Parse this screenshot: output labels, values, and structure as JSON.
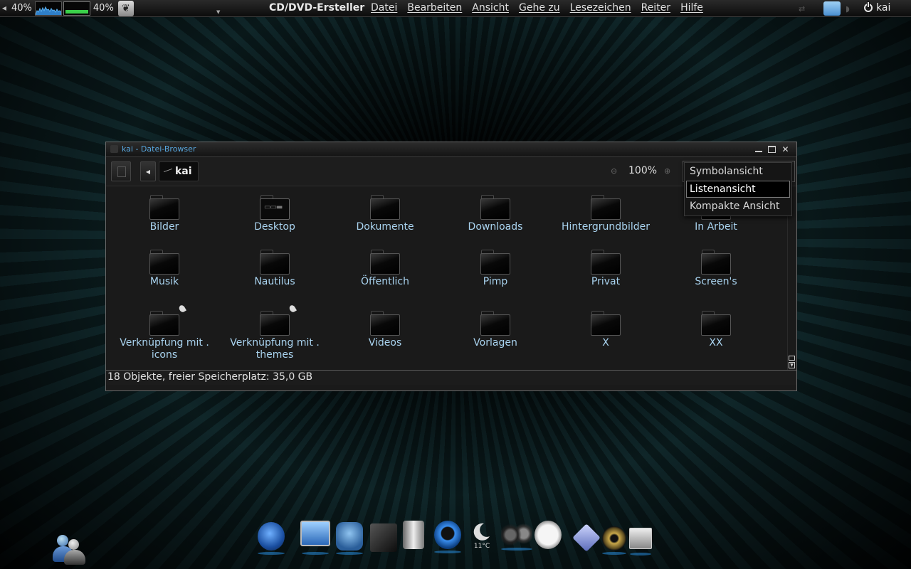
{
  "top_panel": {
    "cpu_percent": "40%",
    "mem_percent": "40%",
    "app_title": "CD/DVD-Ersteller",
    "menu": [
      "Datei",
      "Bearbeiten",
      "Ansicht",
      "Gehe zu",
      "Lesezeichen",
      "Reiter",
      "Hilfe"
    ],
    "user": "kai"
  },
  "window": {
    "title": "kai - Datei-Browser",
    "path": "kai",
    "zoom": "100%",
    "view_options": [
      "Symbolansicht",
      "Listenansicht",
      "Kompakte Ansicht"
    ],
    "selected_view": "Listenansicht",
    "items": [
      {
        "label": "Bilder",
        "kind": "folder"
      },
      {
        "label": "Desktop",
        "kind": "desktop"
      },
      {
        "label": "Dokumente",
        "kind": "folder"
      },
      {
        "label": "Downloads",
        "kind": "folder"
      },
      {
        "label": "Hintergrundbilder",
        "kind": "folder"
      },
      {
        "label": "In Arbeit",
        "kind": "folder"
      },
      {
        "label": "Musik",
        "kind": "folder"
      },
      {
        "label": "Nautilus",
        "kind": "folder"
      },
      {
        "label": "Öffentlich",
        "kind": "folder"
      },
      {
        "label": "Pimp",
        "kind": "folder"
      },
      {
        "label": "Privat",
        "kind": "folder"
      },
      {
        "label": "Screen's",
        "kind": "folder"
      },
      {
        "label": "Verknüpfung mit . icons",
        "kind": "link"
      },
      {
        "label": "Verknüpfung mit . themes",
        "kind": "link"
      },
      {
        "label": "Videos",
        "kind": "folder"
      },
      {
        "label": "Vorlagen",
        "kind": "folder"
      },
      {
        "label": "X",
        "kind": "folder"
      },
      {
        "label": "XX",
        "kind": "folder"
      }
    ],
    "status": "18 Objekte, freier Speicherplatz: 35,0 GB"
  },
  "dock": {
    "items": [
      "firefox-icon",
      "computer-icon",
      "steam-icon",
      "file-manager-icon",
      "trash-icon",
      "quicktime-icon",
      "weather-icon",
      "media-player-icon",
      "clock-icon",
      "diamond-icon",
      "speaker-icon",
      "window-switcher-icon"
    ],
    "temperature": "11°C"
  }
}
